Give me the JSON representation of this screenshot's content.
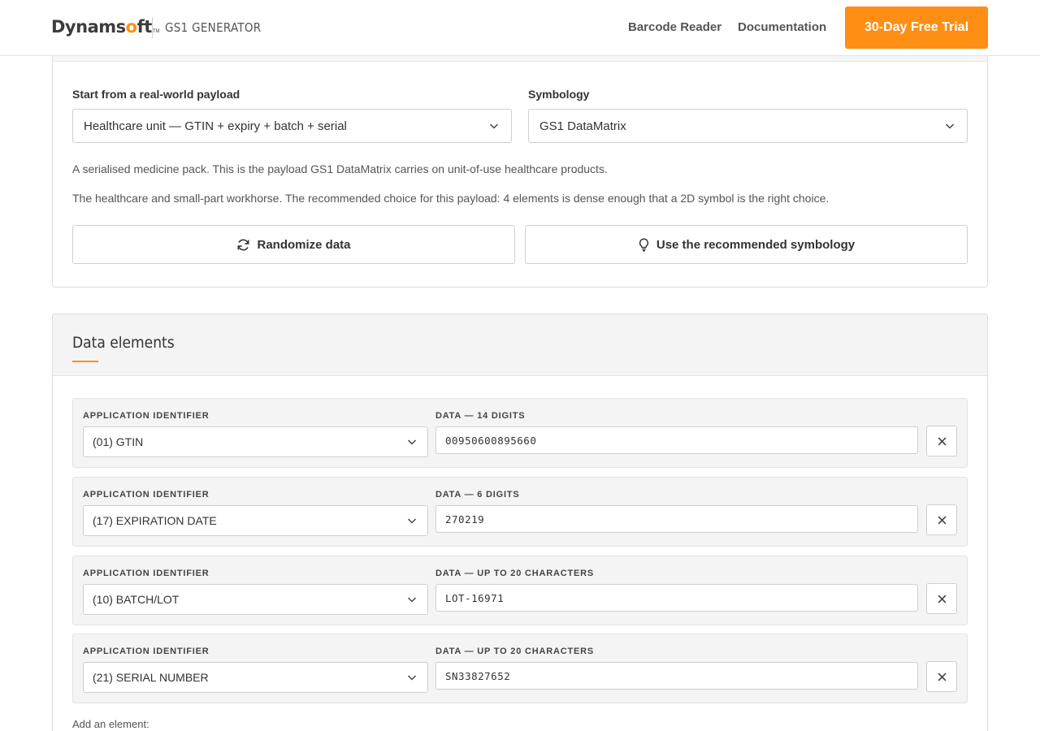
{
  "header": {
    "logo_text_main": "Dynams",
    "logo_text_accent": "o",
    "logo_text_end": "ft",
    "logo_tm": "TM",
    "product_name": "GS1 GENERATOR",
    "nav": [
      {
        "label": "Barcode Reader"
      },
      {
        "label": "Documentation"
      }
    ],
    "cta_label": "30-Day Free Trial"
  },
  "colors": {
    "accent": "#fe8e14",
    "card_header_bg": "#f4f4f4",
    "border": "#dcdcdc"
  },
  "payload": {
    "label": "Start from a real-world payload",
    "selected": "Healthcare unit — GTIN + expiry + batch + serial"
  },
  "symbology": {
    "label": "Symbology",
    "selected": "GS1 DataMatrix"
  },
  "descriptions": {
    "payload_desc": "A serialised medicine pack. This is the payload GS1 DataMatrix carries on unit-of-use healthcare products.",
    "symbology_desc": "The healthcare and small-part workhorse. The recommended choice for this payload: 4 elements is dense enough that a 2D symbol is the right choice."
  },
  "actions": {
    "randomize_label": "Randomize data",
    "recommend_label": "Use the recommended symbology"
  },
  "data_elements": {
    "title": "Data elements",
    "rows": [
      {
        "ai_label": "APPLICATION IDENTIFIER",
        "ai_value": "(01) GTIN",
        "data_label": "DATA — 14 DIGITS",
        "data_value": "00950600895660"
      },
      {
        "ai_label": "APPLICATION IDENTIFIER",
        "ai_value": "(17) EXPIRATION DATE",
        "data_label": "DATA — 6 DIGITS",
        "data_value": "270219"
      },
      {
        "ai_label": "APPLICATION IDENTIFIER",
        "ai_value": "(10) BATCH/LOT",
        "data_label": "DATA — UP TO 20 CHARACTERS",
        "data_value": "LOT-16971"
      },
      {
        "ai_label": "APPLICATION IDENTIFIER",
        "ai_value": "(21) SERIAL NUMBER",
        "data_label": "DATA — UP TO 20 CHARACTERS",
        "data_value": "SN33827652"
      }
    ],
    "add_label": "Add an element:"
  }
}
